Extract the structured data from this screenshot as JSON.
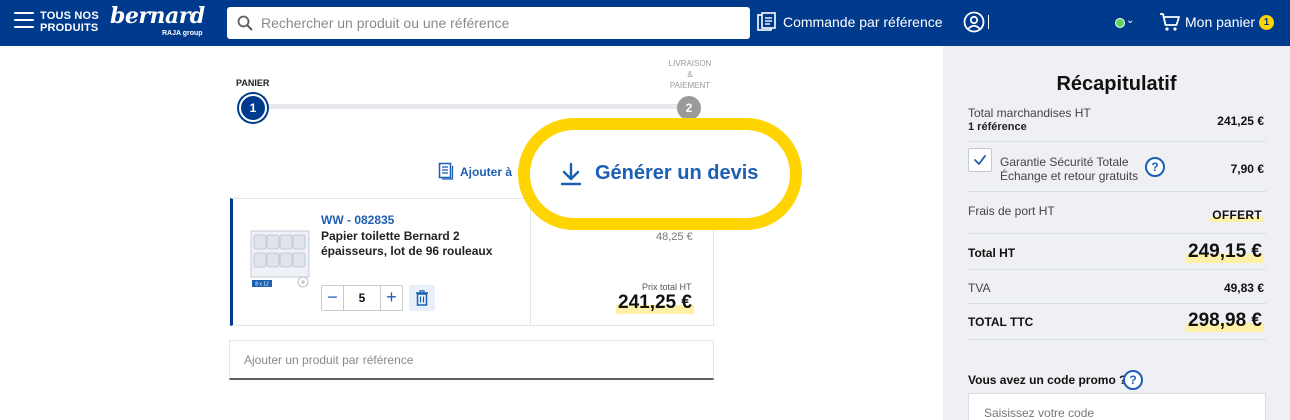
{
  "header": {
    "menu_label_line1": "TOUS NOS",
    "menu_label_line2": "PRODUITS",
    "logo_text": "bernard",
    "logo_subtext": "RAJA group",
    "search_placeholder": "Rechercher un produit ou une référence",
    "order_by_ref_label": "Commande par référence",
    "cart_label": "Mon panier",
    "cart_count": "1",
    "status_color": "#5fd35a"
  },
  "stepper": {
    "step1_label": "PANIER",
    "step1_number": "1",
    "step2_label_line1": "LIVRAISON",
    "step2_label_line2": "&",
    "step2_label_line3": "PAIEMENT",
    "step2_number": "2"
  },
  "actions": {
    "add_to_label": "Ajouter à",
    "generate_quote_label": "Générer un devis"
  },
  "cart_item": {
    "reference": "WW - 082835",
    "name": "Papier toilette Bernard 2 épaisseurs, lot de 96 rouleaux",
    "quantity": "5",
    "unit_price": "48,25 €",
    "total_label": "Prix total HT",
    "total_value": "241,25 €",
    "image_caption": "8 x 12"
  },
  "add_by_reference": {
    "placeholder": "Ajouter un produit par référence"
  },
  "summary": {
    "title": "Récapitulatif",
    "merch_label": "Total marchandises HT",
    "merch_sub": "1 référence",
    "merch_value": "241,25 €",
    "warranty_line1": "Garantie Sécurité Totale",
    "warranty_line2": "Échange et retour gratuits",
    "warranty_value": "7,90 €",
    "shipping_label": "Frais de port HT",
    "shipping_value": "OFFERT",
    "total_ht_label": "Total HT",
    "total_ht_value": "249,15 €",
    "tva_label": "TVA",
    "tva_value": "49,83 €",
    "total_ttc_label": "TOTAL TTC",
    "total_ttc_value": "298,98 €",
    "promo_label": "Vous avez un code promo ?",
    "promo_placeholder": "Saisissez votre code",
    "help_glyph": "?"
  },
  "colors": {
    "brand_blue": "#003a8c",
    "link_blue": "#1d5fb4",
    "highlight_yellow": "#ffd400"
  }
}
